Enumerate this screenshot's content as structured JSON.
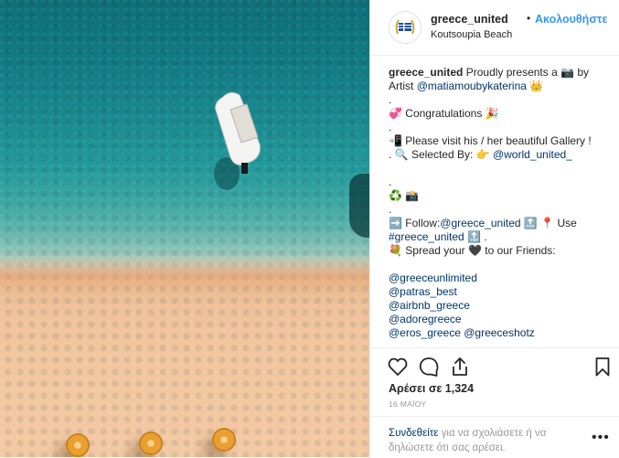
{
  "post": {
    "username": "greece_united",
    "separator": "•",
    "follow_label": "Ακολουθήστε",
    "location": "Koutsoupia Beach"
  },
  "caption": {
    "l1_user": "greece_united",
    "l1_text": "Proudly presents a 📷 by",
    "l2_text": "Artist",
    "l2_mention": "@matiamoubykaterina",
    "l2_emoji": "👑",
    "l3": ".",
    "l4": "💞 Congratulations 🎉",
    "l5": ".",
    "l6": "📲 Please visit his / her beautiful Gallery !",
    "l7_text": ". 🔍 Selected By: 👉",
    "l7_mention": "@world_united_",
    "l8": ".",
    "l9": "♻️ 📸",
    "l10": ".",
    "l11_text1": "➡️ Follow:",
    "l11_mention": "@greece_united",
    "l11_text2": "🔝 📍 Use",
    "l12_hashtag": "#greece_united",
    "l12_text": "🔝 .",
    "l13": "💐 Spread your 🖤 to our Friends:",
    "l14": "",
    "mentions": [
      "@greeceunlimited",
      "@patras_best",
      "@airbnb_greece",
      "@adoregreece"
    ],
    "last_mention_1": "@eros_greece",
    "last_mention_2": "@greeceshotz"
  },
  "actions": {
    "likes": "Αρέσει σε 1,324",
    "date": "16 ΜΑΪΟΥ"
  },
  "comment": {
    "login_link": "Συνδεθείτε",
    "prompt": "για να σχολιάσετε ή να δηλώσετε ότι σας αρέσει.",
    "more": "•••"
  },
  "colors": {
    "link_blue": "#3897f0",
    "mention_blue": "#003569",
    "muted": "#999999"
  }
}
